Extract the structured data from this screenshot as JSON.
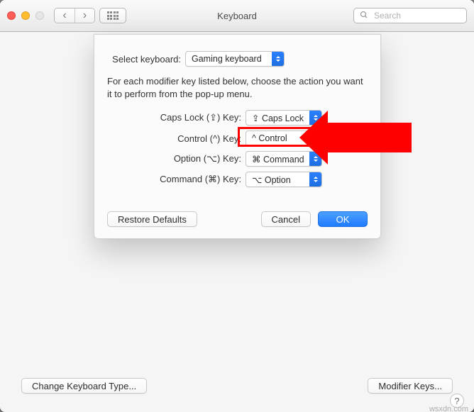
{
  "toolbar": {
    "title": "Keyboard",
    "search_placeholder": "Search"
  },
  "sheet": {
    "select_keyboard_label": "Select keyboard:",
    "selected_keyboard": "Gaming keyboard",
    "description": "For each modifier key listed below, choose the action you want it to perform from the pop-up menu.",
    "rows": {
      "caps_lock": {
        "label": "Caps Lock (⇪) Key:",
        "value": "⇪ Caps Lock"
      },
      "control": {
        "label": "Control (^) Key:",
        "value": "^ Control"
      },
      "option": {
        "label": "Option (⌥) Key:",
        "value": "⌘ Command"
      },
      "command": {
        "label": "Command (⌘) Key:",
        "value": "⌥ Option"
      }
    },
    "buttons": {
      "restore": "Restore Defaults",
      "cancel": "Cancel",
      "ok": "OK"
    }
  },
  "bottom": {
    "change_type": "Change Keyboard Type...",
    "modifier_keys": "Modifier Keys..."
  },
  "watermark": "wsxdn.com"
}
